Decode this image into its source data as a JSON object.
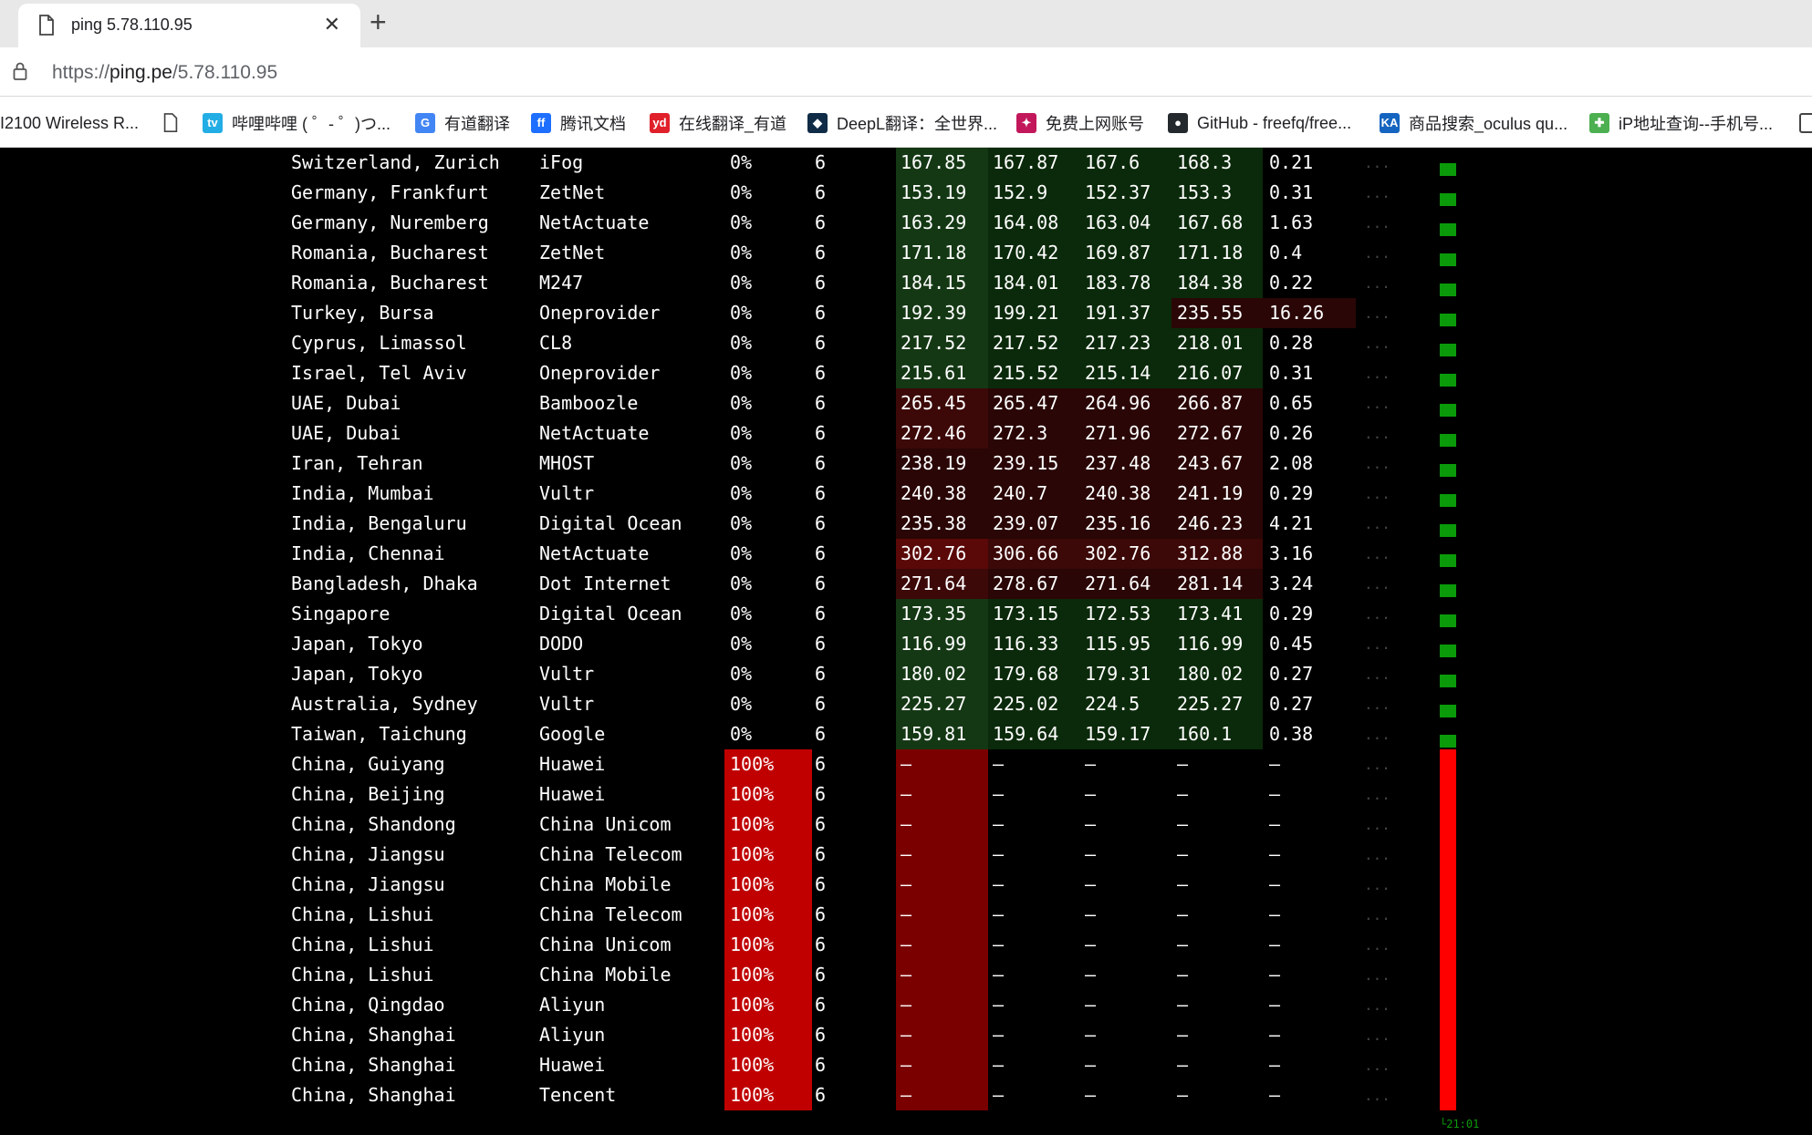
{
  "browser": {
    "tab_title": "ping 5.78.110.95",
    "close_glyph": "✕",
    "newtab_glyph": "+",
    "url_scheme": "https://",
    "url_host": "ping.pe",
    "url_path": "/5.78.110.95"
  },
  "bookmarks": [
    {
      "label": "I2100 Wireless R...",
      "icon": "none"
    },
    {
      "label": "",
      "icon": "page-icon"
    },
    {
      "label": "哔哩哔哩 ( ゜- ゜)つ...",
      "icon": "bilibili-icon",
      "color": "#23ade5"
    },
    {
      "label": "有道翻译",
      "icon": "google-icon",
      "color": "#4285f4"
    },
    {
      "label": "腾讯文档",
      "icon": "tencent-docs-icon",
      "color": "#1e6fff"
    },
    {
      "label": "在线翻译_有道",
      "icon": "youdao-icon",
      "color": "#e0202a"
    },
    {
      "label": "DeepL翻译：全世界...",
      "icon": "deepl-icon",
      "color": "#0f2b46"
    },
    {
      "label": "免费上网账号",
      "icon": "bookmark-site-icon",
      "color": "#c2185b"
    },
    {
      "label": "GitHub - freefq/free...",
      "icon": "github-icon",
      "color": "#24292e"
    },
    {
      "label": "商品搜索_oculus qu...",
      "icon": "ka-icon",
      "color": "#1565c0"
    },
    {
      "label": "iP地址查询--手机号...",
      "icon": "ip-icon",
      "color": "#4caf50"
    },
    {
      "label": "",
      "icon": "folder-icon"
    }
  ],
  "table": {
    "rows": [
      {
        "location": "Switzerland, Zurich",
        "provider": "iFog",
        "loss": "0%",
        "sent": "6",
        "last": "167.85",
        "avg": "167.87",
        "best": "167.6",
        "worst": "168.3",
        "stdev": "0.21",
        "dots": "...",
        "status": "ok",
        "heat": [
          "g2",
          "g1",
          "g1",
          "g1",
          "n"
        ]
      },
      {
        "location": "Germany, Frankfurt",
        "provider": "ZetNet",
        "loss": "0%",
        "sent": "6",
        "last": "153.19",
        "avg": "152.9",
        "best": "152.37",
        "worst": "153.3",
        "stdev": "0.31",
        "dots": "...",
        "status": "ok",
        "heat": [
          "g2",
          "g1",
          "g1",
          "g1",
          "n"
        ]
      },
      {
        "location": "Germany, Nuremberg",
        "provider": "NetActuate",
        "loss": "0%",
        "sent": "6",
        "last": "163.29",
        "avg": "164.08",
        "best": "163.04",
        "worst": "167.68",
        "stdev": "1.63",
        "dots": "...",
        "status": "ok",
        "heat": [
          "g2",
          "g1",
          "g1",
          "g1",
          "n"
        ]
      },
      {
        "location": "Romania, Bucharest",
        "provider": "ZetNet",
        "loss": "0%",
        "sent": "6",
        "last": "171.18",
        "avg": "170.42",
        "best": "169.87",
        "worst": "171.18",
        "stdev": "0.4",
        "dots": "...",
        "status": "ok",
        "heat": [
          "g2",
          "g1",
          "g1",
          "g1",
          "n"
        ]
      },
      {
        "location": "Romania, Bucharest",
        "provider": "M247",
        "loss": "0%",
        "sent": "6",
        "last": "184.15",
        "avg": "184.01",
        "best": "183.78",
        "worst": "184.38",
        "stdev": "0.22",
        "dots": "...",
        "status": "ok",
        "heat": [
          "g2",
          "g1",
          "g1",
          "g1",
          "n"
        ]
      },
      {
        "location": "Turkey, Bursa",
        "provider": "Oneprovider",
        "loss": "0%",
        "sent": "6",
        "last": "192.39",
        "avg": "199.21",
        "best": "191.37",
        "worst": "235.55",
        "stdev": "16.26",
        "dots": "...",
        "status": "ok",
        "heat": [
          "g2",
          "g1",
          "g1",
          "r1",
          "r1"
        ]
      },
      {
        "location": "Cyprus, Limassol",
        "provider": "CL8",
        "loss": "0%",
        "sent": "6",
        "last": "217.52",
        "avg": "217.52",
        "best": "217.23",
        "worst": "218.01",
        "stdev": "0.28",
        "dots": "...",
        "status": "ok",
        "heat": [
          "g2",
          "g1",
          "g1",
          "g1",
          "n"
        ]
      },
      {
        "location": "Israel, Tel Aviv",
        "provider": "Oneprovider",
        "loss": "0%",
        "sent": "6",
        "last": "215.61",
        "avg": "215.52",
        "best": "215.14",
        "worst": "216.07",
        "stdev": "0.31",
        "dots": "...",
        "status": "ok",
        "heat": [
          "g2",
          "g1",
          "g1",
          "g1",
          "n"
        ]
      },
      {
        "location": "UAE, Dubai",
        "provider": "Bamboozle",
        "loss": "0%",
        "sent": "6",
        "last": "265.45",
        "avg": "265.47",
        "best": "264.96",
        "worst": "266.87",
        "stdev": "0.65",
        "dots": "...",
        "status": "ok",
        "heat": [
          "r2",
          "r1",
          "r1",
          "r1",
          "n"
        ]
      },
      {
        "location": "UAE, Dubai",
        "provider": "NetActuate",
        "loss": "0%",
        "sent": "6",
        "last": "272.46",
        "avg": "272.3",
        "best": "271.96",
        "worst": "272.67",
        "stdev": "0.26",
        "dots": "...",
        "status": "ok",
        "heat": [
          "r2",
          "r1",
          "r1",
          "r1",
          "n"
        ]
      },
      {
        "location": "Iran, Tehran",
        "provider": "MHOST",
        "loss": "0%",
        "sent": "6",
        "last": "238.19",
        "avg": "239.15",
        "best": "237.48",
        "worst": "243.67",
        "stdev": "2.08",
        "dots": "...",
        "status": "ok",
        "heat": [
          "r1",
          "r1",
          "r1",
          "r1",
          "n"
        ]
      },
      {
        "location": "India, Mumbai",
        "provider": "Vultr",
        "loss": "0%",
        "sent": "6",
        "last": "240.38",
        "avg": "240.7",
        "best": "240.38",
        "worst": "241.19",
        "stdev": "0.29",
        "dots": "...",
        "status": "ok",
        "heat": [
          "r1",
          "r1",
          "r1",
          "r1",
          "n"
        ]
      },
      {
        "location": "India, Bengaluru",
        "provider": "Digital Ocean",
        "loss": "0%",
        "sent": "6",
        "last": "235.38",
        "avg": "239.07",
        "best": "235.16",
        "worst": "246.23",
        "stdev": "4.21",
        "dots": "...",
        "status": "ok",
        "heat": [
          "r1",
          "r1",
          "r1",
          "r1",
          "n"
        ]
      },
      {
        "location": "India, Chennai",
        "provider": "NetActuate",
        "loss": "0%",
        "sent": "6",
        "last": "302.76",
        "avg": "306.66",
        "best": "302.76",
        "worst": "312.88",
        "stdev": "3.16",
        "dots": "...",
        "status": "ok",
        "heat": [
          "r3",
          "r2",
          "r2",
          "r2",
          "n"
        ]
      },
      {
        "location": "Bangladesh, Dhaka",
        "provider": "Dot Internet",
        "loss": "0%",
        "sent": "6",
        "last": "271.64",
        "avg": "278.67",
        "best": "271.64",
        "worst": "281.14",
        "stdev": "3.24",
        "dots": "...",
        "status": "ok",
        "heat": [
          "r2",
          "r1",
          "r1",
          "r1",
          "n"
        ]
      },
      {
        "location": "Singapore",
        "provider": "Digital Ocean",
        "loss": "0%",
        "sent": "6",
        "last": "173.35",
        "avg": "173.15",
        "best": "172.53",
        "worst": "173.41",
        "stdev": "0.29",
        "dots": "...",
        "status": "ok",
        "heat": [
          "g2",
          "g1",
          "g1",
          "g1",
          "n"
        ]
      },
      {
        "location": "Japan, Tokyo",
        "provider": "DODO",
        "loss": "0%",
        "sent": "6",
        "last": "116.99",
        "avg": "116.33",
        "best": "115.95",
        "worst": "116.99",
        "stdev": "0.45",
        "dots": "...",
        "status": "ok",
        "heat": [
          "g2",
          "g1",
          "g1",
          "g1",
          "n"
        ]
      },
      {
        "location": "Japan, Tokyo",
        "provider": "Vultr",
        "loss": "0%",
        "sent": "6",
        "last": "180.02",
        "avg": "179.68",
        "best": "179.31",
        "worst": "180.02",
        "stdev": "0.27",
        "dots": "...",
        "status": "ok",
        "heat": [
          "g2",
          "g1",
          "g1",
          "g1",
          "n"
        ]
      },
      {
        "location": "Australia, Sydney",
        "provider": "Vultr",
        "loss": "0%",
        "sent": "6",
        "last": "225.27",
        "avg": "225.02",
        "best": "224.5",
        "worst": "225.27",
        "stdev": "0.27",
        "dots": "...",
        "status": "ok",
        "heat": [
          "g2",
          "g1",
          "g1",
          "g1",
          "n"
        ]
      },
      {
        "location": "Taiwan, Taichung",
        "provider": "Google",
        "loss": "0%",
        "sent": "6",
        "last": "159.81",
        "avg": "159.64",
        "best": "159.17",
        "worst": "160.1",
        "stdev": "0.38",
        "dots": "...",
        "status": "ok",
        "heat": [
          "g2",
          "g1",
          "g1",
          "g1",
          "n"
        ]
      },
      {
        "location": "China, Guiyang",
        "provider": "Huawei",
        "loss": "100%",
        "sent": "6",
        "last": "—",
        "avg": "—",
        "best": "—",
        "worst": "—",
        "stdev": "—",
        "dots": "...",
        "status": "fail"
      },
      {
        "location": "China, Beijing",
        "provider": "Huawei",
        "loss": "100%",
        "sent": "6",
        "last": "—",
        "avg": "—",
        "best": "—",
        "worst": "—",
        "stdev": "—",
        "dots": "...",
        "status": "fail"
      },
      {
        "location": "China, Shandong",
        "provider": "China Unicom",
        "loss": "100%",
        "sent": "6",
        "last": "—",
        "avg": "—",
        "best": "—",
        "worst": "—",
        "stdev": "—",
        "dots": "...",
        "status": "fail"
      },
      {
        "location": "China, Jiangsu",
        "provider": "China Telecom",
        "loss": "100%",
        "sent": "6",
        "last": "—",
        "avg": "—",
        "best": "—",
        "worst": "—",
        "stdev": "—",
        "dots": "...",
        "status": "fail"
      },
      {
        "location": "China, Jiangsu",
        "provider": "China Mobile",
        "loss": "100%",
        "sent": "6",
        "last": "—",
        "avg": "—",
        "best": "—",
        "worst": "—",
        "stdev": "—",
        "dots": "...",
        "status": "fail"
      },
      {
        "location": "China, Lishui",
        "provider": "China Telecom",
        "loss": "100%",
        "sent": "6",
        "last": "—",
        "avg": "—",
        "best": "—",
        "worst": "—",
        "stdev": "—",
        "dots": "...",
        "status": "fail"
      },
      {
        "location": "China, Lishui",
        "provider": "China Unicom",
        "loss": "100%",
        "sent": "6",
        "last": "—",
        "avg": "—",
        "best": "—",
        "worst": "—",
        "stdev": "—",
        "dots": "...",
        "status": "fail"
      },
      {
        "location": "China, Lishui",
        "provider": "China Mobile",
        "loss": "100%",
        "sent": "6",
        "last": "—",
        "avg": "—",
        "best": "—",
        "worst": "—",
        "stdev": "—",
        "dots": "...",
        "status": "fail"
      },
      {
        "location": "China, Qingdao",
        "provider": "Aliyun",
        "loss": "100%",
        "sent": "6",
        "last": "—",
        "avg": "—",
        "best": "—",
        "worst": "—",
        "stdev": "—",
        "dots": "...",
        "status": "fail"
      },
      {
        "location": "China, Shanghai",
        "provider": "Aliyun",
        "loss": "100%",
        "sent": "6",
        "last": "—",
        "avg": "—",
        "best": "—",
        "worst": "—",
        "stdev": "—",
        "dots": "...",
        "status": "fail"
      },
      {
        "location": "China, Shanghai",
        "provider": "Huawei",
        "loss": "100%",
        "sent": "6",
        "last": "—",
        "avg": "—",
        "best": "—",
        "worst": "—",
        "stdev": "—",
        "dots": "...",
        "status": "fail"
      },
      {
        "location": "China, Shanghai",
        "provider": "Tencent",
        "loss": "100%",
        "sent": "6",
        "last": "—",
        "avg": "—",
        "best": "—",
        "worst": "—",
        "stdev": "—",
        "dots": "...",
        "status": "fail"
      }
    ],
    "timestamp": "21:01"
  },
  "colors": {
    "ok_bar": "#0a9a0a",
    "fail_bar": "#ff0000",
    "loss_cell": "#c00000",
    "fail_last_cell": "#7a0000"
  }
}
